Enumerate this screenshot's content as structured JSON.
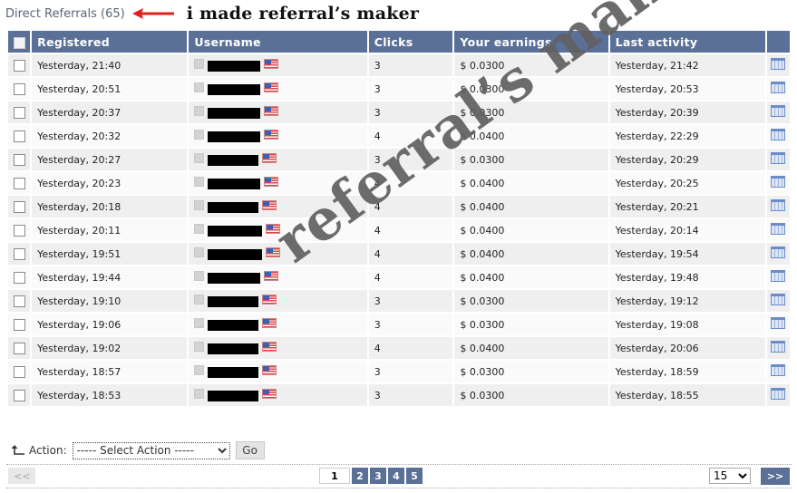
{
  "header": {
    "title": "Direct Referrals (65)",
    "annotation": "i made referral’s maker"
  },
  "table": {
    "columns": [
      "Registered",
      "Username",
      "Clicks",
      "Your earnings",
      "Last activity"
    ],
    "rows": [
      {
        "registered": "Yesterday, 21:40",
        "clicks": "3",
        "earnings": "$ 0.0300",
        "last_activity": "Yesterday, 21:42"
      },
      {
        "registered": "Yesterday, 20:51",
        "clicks": "3",
        "earnings": "$ 0.0300",
        "last_activity": "Yesterday, 20:53"
      },
      {
        "registered": "Yesterday, 20:37",
        "clicks": "3",
        "earnings": "$ 0.0300",
        "last_activity": "Yesterday, 20:39"
      },
      {
        "registered": "Yesterday, 20:32",
        "clicks": "4",
        "earnings": "$ 0.0400",
        "last_activity": "Yesterday, 22:29"
      },
      {
        "registered": "Yesterday, 20:27",
        "clicks": "3",
        "earnings": "$ 0.0300",
        "last_activity": "Yesterday, 20:29"
      },
      {
        "registered": "Yesterday, 20:23",
        "clicks": "4",
        "earnings": "$ 0.0400",
        "last_activity": "Yesterday, 20:25"
      },
      {
        "registered": "Yesterday, 20:18",
        "clicks": "4",
        "earnings": "$ 0.0400",
        "last_activity": "Yesterday, 20:21"
      },
      {
        "registered": "Yesterday, 20:11",
        "clicks": "4",
        "earnings": "$ 0.0400",
        "last_activity": "Yesterday, 20:14"
      },
      {
        "registered": "Yesterday, 19:51",
        "clicks": "4",
        "earnings": "$ 0.0400",
        "last_activity": "Yesterday, 19:54"
      },
      {
        "registered": "Yesterday, 19:44",
        "clicks": "4",
        "earnings": "$ 0.0400",
        "last_activity": "Yesterday, 19:48"
      },
      {
        "registered": "Yesterday, 19:10",
        "clicks": "3",
        "earnings": "$ 0.0300",
        "last_activity": "Yesterday, 19:12"
      },
      {
        "registered": "Yesterday, 19:06",
        "clicks": "3",
        "earnings": "$ 0.0300",
        "last_activity": "Yesterday, 19:08"
      },
      {
        "registered": "Yesterday, 19:02",
        "clicks": "4",
        "earnings": "$ 0.0400",
        "last_activity": "Yesterday, 20:06"
      },
      {
        "registered": "Yesterday, 18:57",
        "clicks": "3",
        "earnings": "$ 0.0300",
        "last_activity": "Yesterday, 18:59"
      },
      {
        "registered": "Yesterday, 18:53",
        "clicks": "3",
        "earnings": "$ 0.0300",
        "last_activity": "Yesterday, 18:55"
      }
    ],
    "row_icon": "calendar-icon",
    "username_flag": "us-flag-icon",
    "username_redacted": true
  },
  "actions": {
    "label": "Action:",
    "select_value": "----- Select Action -----",
    "go_label": "Go"
  },
  "pagination": {
    "prev_label": "<<",
    "next_label": ">>",
    "pages": [
      "1",
      "2",
      "3",
      "4",
      "5"
    ],
    "current_page": "1",
    "per_page": "15"
  },
  "watermark": "referral’s maker",
  "colors": {
    "header_bg": "#5b7097",
    "row_odd": "#efefef",
    "row_even": "#fafafa",
    "annotation_arrow": "#e0201a"
  }
}
